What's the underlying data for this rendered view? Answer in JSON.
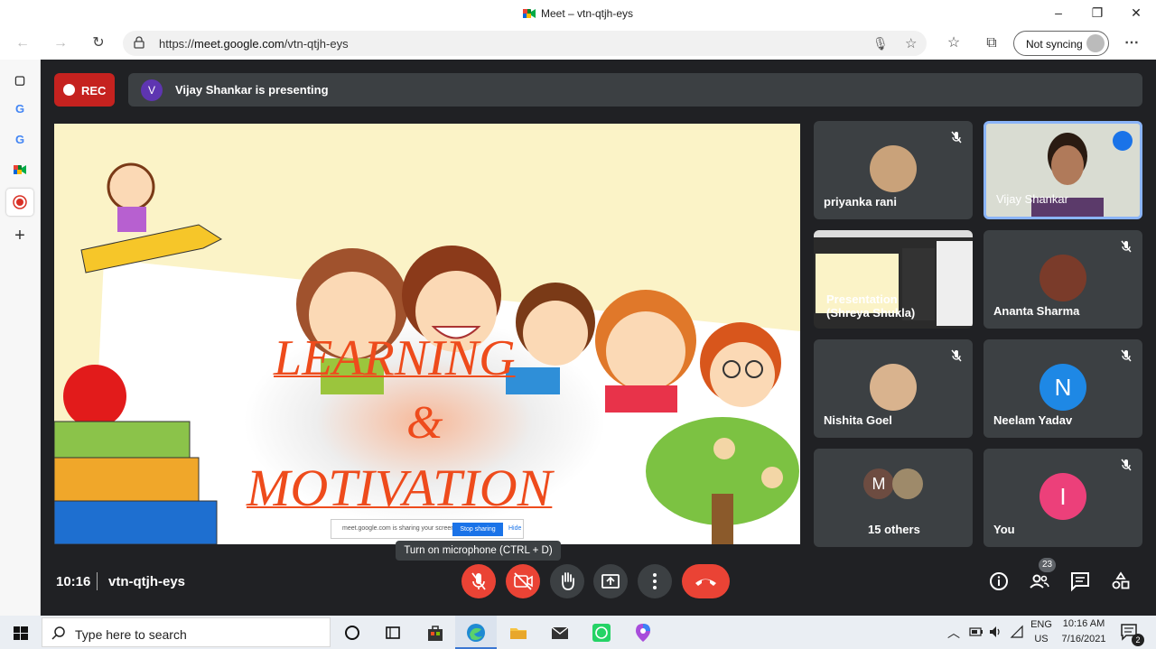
{
  "browser": {
    "window_title": "Meet – vtn-qtjh-eys",
    "url_prefix": "https://",
    "url_host": "meet.google.com",
    "url_path": "/vtn-qtjh-eys",
    "sync_label": "Not syncing"
  },
  "meet": {
    "rec_label": "REC",
    "presenter_initial": "V",
    "presenting_text": "Vijay Shankar is presenting",
    "slide": {
      "line1": "LEARNING",
      "line2": "&",
      "line3": "MOTIVATION",
      "share_text": "meet.google.com is sharing your screen.",
      "stop_label": "Stop sharing",
      "hide_label": "Hide"
    },
    "participants": [
      {
        "name": "priyanka rani"
      },
      {
        "name": "Vijay Shankar"
      },
      {
        "name": "Presentation (Shreya Shukla)"
      },
      {
        "name": "Ananta Sharma"
      },
      {
        "name": "Nishita Goel"
      },
      {
        "name": "Neelam Yadav",
        "initial": "N",
        "color": "#1e88e5"
      },
      {
        "name": "15 others",
        "initial": "M",
        "color": "#6d4c41"
      },
      {
        "name": "You",
        "initial": "I",
        "color": "#ec407a"
      }
    ],
    "time": "10:16",
    "meeting_code": "vtn-qtjh-eys",
    "tooltip": "Turn on microphone (CTRL + D)",
    "people_count": "23"
  },
  "taskbar": {
    "search_placeholder": "Type here to search",
    "lang_top": "ENG",
    "lang_bottom": "US",
    "time": "10:16 AM",
    "date": "7/16/2021",
    "notif_count": "2"
  },
  "colors": {
    "meet_bg": "#202124",
    "tile_bg": "#3c4043",
    "red": "#ea4335",
    "active_border": "#8ab4f8"
  }
}
